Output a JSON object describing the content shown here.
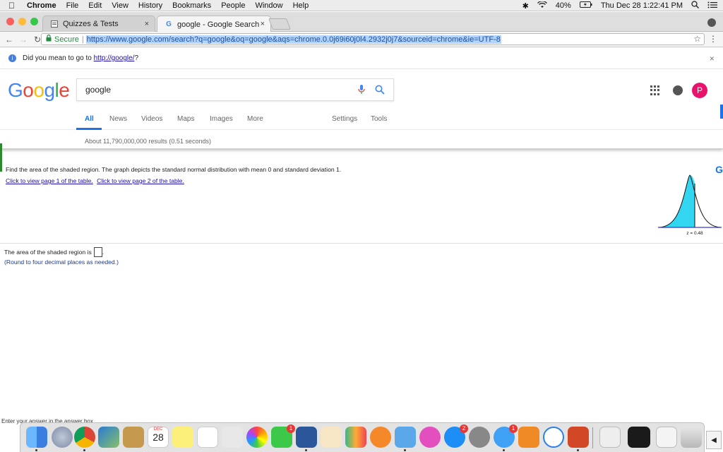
{
  "menubar": {
    "app": "Chrome",
    "items": [
      "File",
      "Edit",
      "View",
      "History",
      "Bookmarks",
      "People",
      "Window",
      "Help"
    ],
    "battery": "40%",
    "clock": "Thu Dec 28  1:22:41 PM"
  },
  "tabs": [
    {
      "title": "Quizzes & Tests",
      "close": "×"
    },
    {
      "title": "google - Google Search",
      "close": "×"
    }
  ],
  "addressbar": {
    "secure_label": "Secure",
    "url": "https://www.google.com/search?q=google&oq=google&aqs=chrome.0.0j69i60j0l4.2932j0j7&sourceid=chrome&ie=UTF-8"
  },
  "did_you_mean": {
    "prefix": "Did you mean to go to ",
    "link": "http://google/",
    "suffix": "?"
  },
  "google": {
    "query": "google",
    "avatar_letter": "P",
    "tabs": [
      "All",
      "News",
      "Videos",
      "Maps",
      "Images",
      "More",
      "Settings",
      "Tools"
    ],
    "stats": "About 11,790,000,000 results (0.51 seconds)"
  },
  "page": {
    "question": "Find the area of the shaded region. The graph depicts the standard normal distribution with mean 0 and standard deviation 1.",
    "link1": "Click to view page 1 of the table.",
    "link2": "Click to view page 2 of the table.",
    "z_label": "z = 0.48",
    "answer_prefix": "The area of the shaded region is",
    "answer_suffix": ".",
    "note": "(Round to four decimal places as needed.)",
    "enter_text": "Enter your answer in the answer box"
  },
  "dock": {
    "calendar_day": "28",
    "calendar_month": "DEC",
    "badges": {
      "facetime": "1",
      "appstore": "2",
      "messages": "1"
    }
  },
  "colors": {
    "google_blue": "#4285F4",
    "google_red": "#EA4335",
    "google_yellow": "#FBBC05",
    "google_green": "#34A853",
    "shade": "#33d6f0"
  }
}
